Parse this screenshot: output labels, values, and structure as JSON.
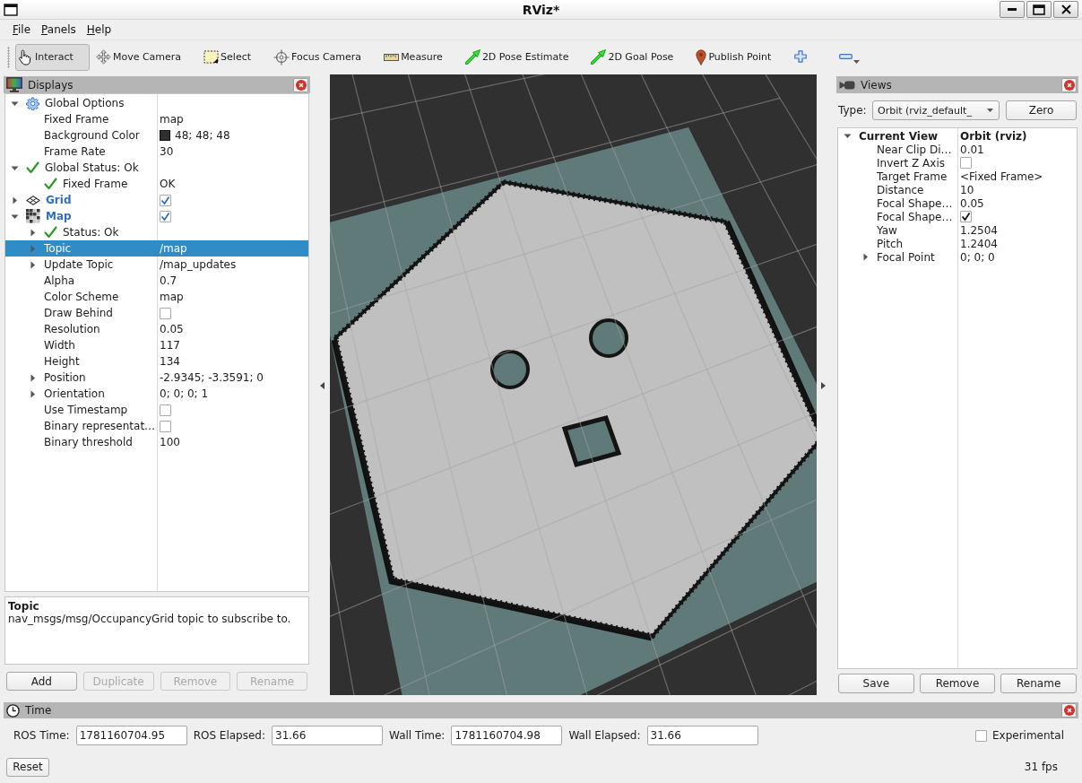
{
  "window": {
    "title": "RViz*"
  },
  "menu": [
    {
      "label": "File"
    },
    {
      "label": "Panels"
    },
    {
      "label": "Help"
    }
  ],
  "toolbar": {
    "tools": [
      {
        "label": "Interact",
        "kind": "interact",
        "selected": true
      },
      {
        "label": "Move Camera",
        "kind": "move",
        "selected": false
      },
      {
        "label": "Select",
        "kind": "select",
        "selected": false
      },
      {
        "label": "Focus Camera",
        "kind": "focus",
        "selected": false
      },
      {
        "label": "Measure",
        "kind": "measure",
        "selected": false
      },
      {
        "label": "2D Pose Estimate",
        "kind": "pose",
        "selected": false
      },
      {
        "label": "2D Goal Pose",
        "kind": "goal",
        "selected": false
      },
      {
        "label": "Publish Point",
        "kind": "point",
        "selected": false
      }
    ]
  },
  "displays": {
    "title": "Displays",
    "tree": [
      {
        "kind": "options",
        "label": "Global Options",
        "expanded": true,
        "selected": false,
        "children": [
          {
            "kind": "property",
            "label": "Fixed Frame",
            "value": "map",
            "selected": false
          },
          {
            "kind": "property",
            "label": "Background Color",
            "value": "48; 48; 48",
            "color": "#303030",
            "selected": false
          },
          {
            "kind": "property",
            "label": "Frame Rate",
            "value": "30",
            "selected": false
          }
        ]
      },
      {
        "kind": "status",
        "label": "Global Status: Ok",
        "expanded": true,
        "selected": false,
        "children": [
          {
            "kind": "status",
            "label": "Fixed Frame",
            "value": "OK",
            "selected": false
          }
        ]
      },
      {
        "kind": "grid",
        "label": "Grid",
        "checked": true,
        "expanded": false,
        "selected": false
      },
      {
        "kind": "map",
        "label": "Map",
        "checked": true,
        "expanded": true,
        "selected": false,
        "children": [
          {
            "kind": "status",
            "label": "Status: Ok",
            "expanded": false,
            "selected": false
          },
          {
            "kind": "property",
            "label": "Topic",
            "value": "/map",
            "expanded": false,
            "selected": true
          },
          {
            "kind": "property",
            "label": "Update Topic",
            "value": "/map_updates",
            "expanded": false,
            "selected": false
          },
          {
            "kind": "property",
            "label": "Alpha",
            "value": "0.7",
            "selected": false
          },
          {
            "kind": "property",
            "label": "Color Scheme",
            "value": "map",
            "selected": false
          },
          {
            "kind": "property",
            "label": "Draw Behind",
            "checked": false,
            "selected": false
          },
          {
            "kind": "property",
            "label": "Resolution",
            "value": "0.05",
            "selected": false
          },
          {
            "kind": "property",
            "label": "Width",
            "value": "117",
            "selected": false
          },
          {
            "kind": "property",
            "label": "Height",
            "value": "134",
            "selected": false
          },
          {
            "kind": "property",
            "label": "Position",
            "value": "-2.9345; -3.3591; 0",
            "expanded": false,
            "selected": false
          },
          {
            "kind": "property",
            "label": "Orientation",
            "value": "0; 0; 0; 1",
            "expanded": false,
            "selected": false
          },
          {
            "kind": "property",
            "label": "Use Timestamp",
            "checked": false,
            "selected": false
          },
          {
            "kind": "property",
            "label": "Binary representat…",
            "checked": false,
            "selected": false
          },
          {
            "kind": "property",
            "label": "Binary threshold",
            "value": "100",
            "selected": false
          }
        ]
      }
    ],
    "description": {
      "title": "Topic",
      "text": "nav_msgs/msg/OccupancyGrid topic to subscribe to."
    },
    "buttons": [
      {
        "label": "Add",
        "disabled": false
      },
      {
        "label": "Duplicate",
        "disabled": true
      },
      {
        "label": "Remove",
        "disabled": true
      },
      {
        "label": "Rename",
        "disabled": true
      }
    ]
  },
  "views": {
    "title": "Views",
    "type_label": "Type:",
    "type_value": "Orbit (rviz_default_",
    "zero_button": "Zero",
    "tree": [
      {
        "kind": "view",
        "label": "Current View",
        "value": "Orbit (rviz)",
        "expanded": true,
        "selected": false,
        "children": [
          {
            "kind": "property",
            "label": "Near Clip Di…",
            "value": "0.01",
            "selected": false
          },
          {
            "kind": "property",
            "label": "Invert Z Axis",
            "checked": false,
            "selected": false
          },
          {
            "kind": "property",
            "label": "Target Frame",
            "value": "<Fixed Frame>",
            "selected": false
          },
          {
            "kind": "property",
            "label": "Distance",
            "value": "10",
            "selected": false
          },
          {
            "kind": "property",
            "label": "Focal Shape…",
            "value": "0.05",
            "selected": false
          },
          {
            "kind": "property",
            "label": "Focal Shape…",
            "checked": true,
            "selected": false
          },
          {
            "kind": "property",
            "label": "Yaw",
            "value": "1.2504",
            "selected": false
          },
          {
            "kind": "property",
            "label": "Pitch",
            "value": "1.2404",
            "selected": false
          },
          {
            "kind": "property",
            "label": "Focal Point",
            "value": "0; 0; 0",
            "expanded": false,
            "selected": false
          }
        ]
      }
    ],
    "buttons": [
      {
        "label": "Save"
      },
      {
        "label": "Remove"
      },
      {
        "label": "Rename"
      }
    ]
  },
  "time": {
    "title": "Time",
    "fields": [
      {
        "label": "ROS Time:",
        "value": "1781160704.95"
      },
      {
        "label": "ROS Elapsed:",
        "value": "31.66"
      },
      {
        "label": "Wall Time:",
        "value": "1781160704.98"
      },
      {
        "label": "Wall Elapsed:",
        "value": "31.66"
      }
    ],
    "experimental": {
      "label": "Experimental",
      "checked": false
    },
    "reset_button": "Reset",
    "fps": "31 fps"
  }
}
